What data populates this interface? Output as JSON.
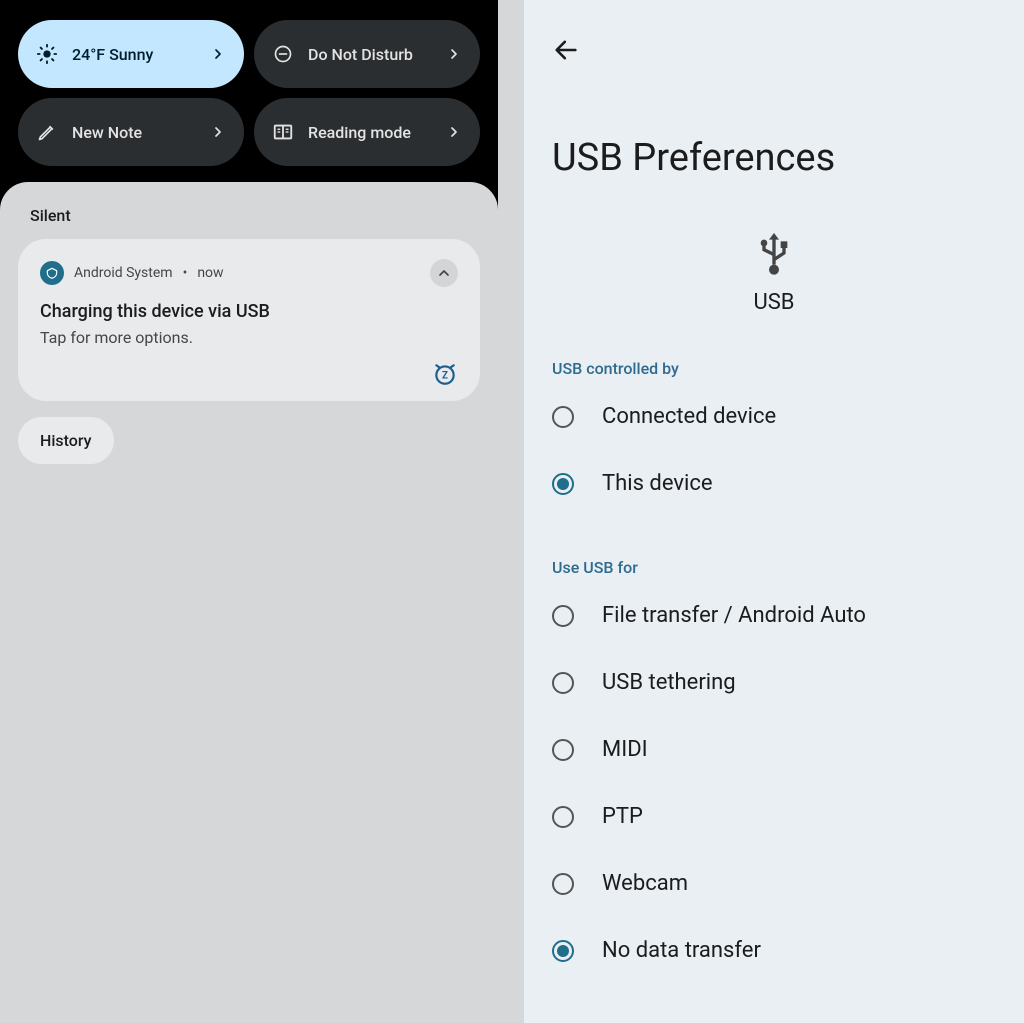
{
  "shade": {
    "tiles": [
      {
        "label": "24°F Sunny",
        "active": true,
        "icon": "weather"
      },
      {
        "label": "Do Not Disturb",
        "active": false,
        "icon": "dnd"
      },
      {
        "label": "New Note",
        "active": false,
        "icon": "pencil"
      },
      {
        "label": "Reading mode",
        "active": false,
        "icon": "reading"
      }
    ],
    "silent_label": "Silent",
    "notification": {
      "app": "Android System",
      "when": "now",
      "title": "Charging this device via USB",
      "text": "Tap for more options."
    },
    "history_label": "History"
  },
  "settings": {
    "title": "USB Preferences",
    "hero_label": "USB",
    "groups": [
      {
        "header": "USB controlled by",
        "options": [
          {
            "label": "Connected device",
            "selected": false
          },
          {
            "label": "This device",
            "selected": true
          }
        ]
      },
      {
        "header": "Use USB for",
        "options": [
          {
            "label": "File transfer / Android Auto",
            "selected": false
          },
          {
            "label": "USB tethering",
            "selected": false
          },
          {
            "label": "MIDI",
            "selected": false
          },
          {
            "label": "PTP",
            "selected": false
          },
          {
            "label": "Webcam",
            "selected": false
          },
          {
            "label": "No data transfer",
            "selected": true
          }
        ]
      }
    ]
  }
}
